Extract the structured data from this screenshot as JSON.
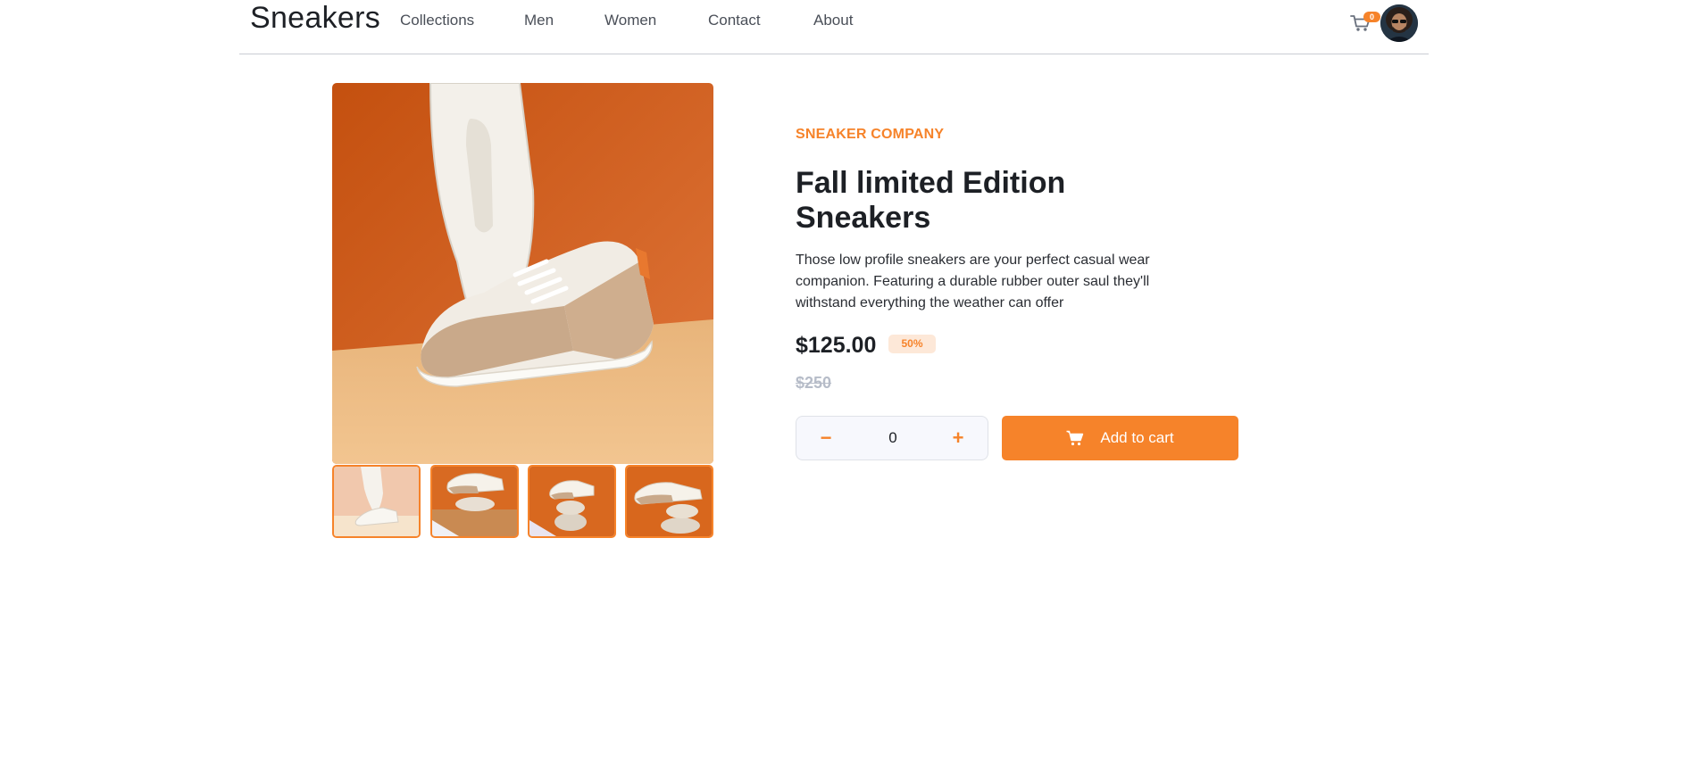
{
  "header": {
    "logo": "Sneakers",
    "nav": [
      "Collections",
      "Men",
      "Women",
      "Contact",
      "About"
    ],
    "cart_count": "0",
    "cart_icon": "cart-icon",
    "avatar_icon": "user-avatar"
  },
  "gallery": {
    "main_image": "sneaker-main-photo",
    "thumbnails": [
      "thumbnail-1",
      "thumbnail-2",
      "thumbnail-3",
      "thumbnail-4"
    ]
  },
  "product": {
    "company": "SNEAKER COMPANY",
    "title": "Fall limited Edition Sneakers",
    "description": "Those low profile sneakers are your perfect casual wear companion. Featuring a durable rubber outer saul they'll withstand everything the weather can offer",
    "price": "$125.00",
    "discount": "50%",
    "old_price": "$250"
  },
  "purchase": {
    "minus": "−",
    "plus": "+",
    "quantity": "0",
    "add_to_cart": "Add to cart"
  },
  "colors": {
    "accent": "#f6832a",
    "accent_pale": "#fde8d8",
    "text_dark": "#1d2025",
    "text_grey": "#b6bcc8"
  }
}
